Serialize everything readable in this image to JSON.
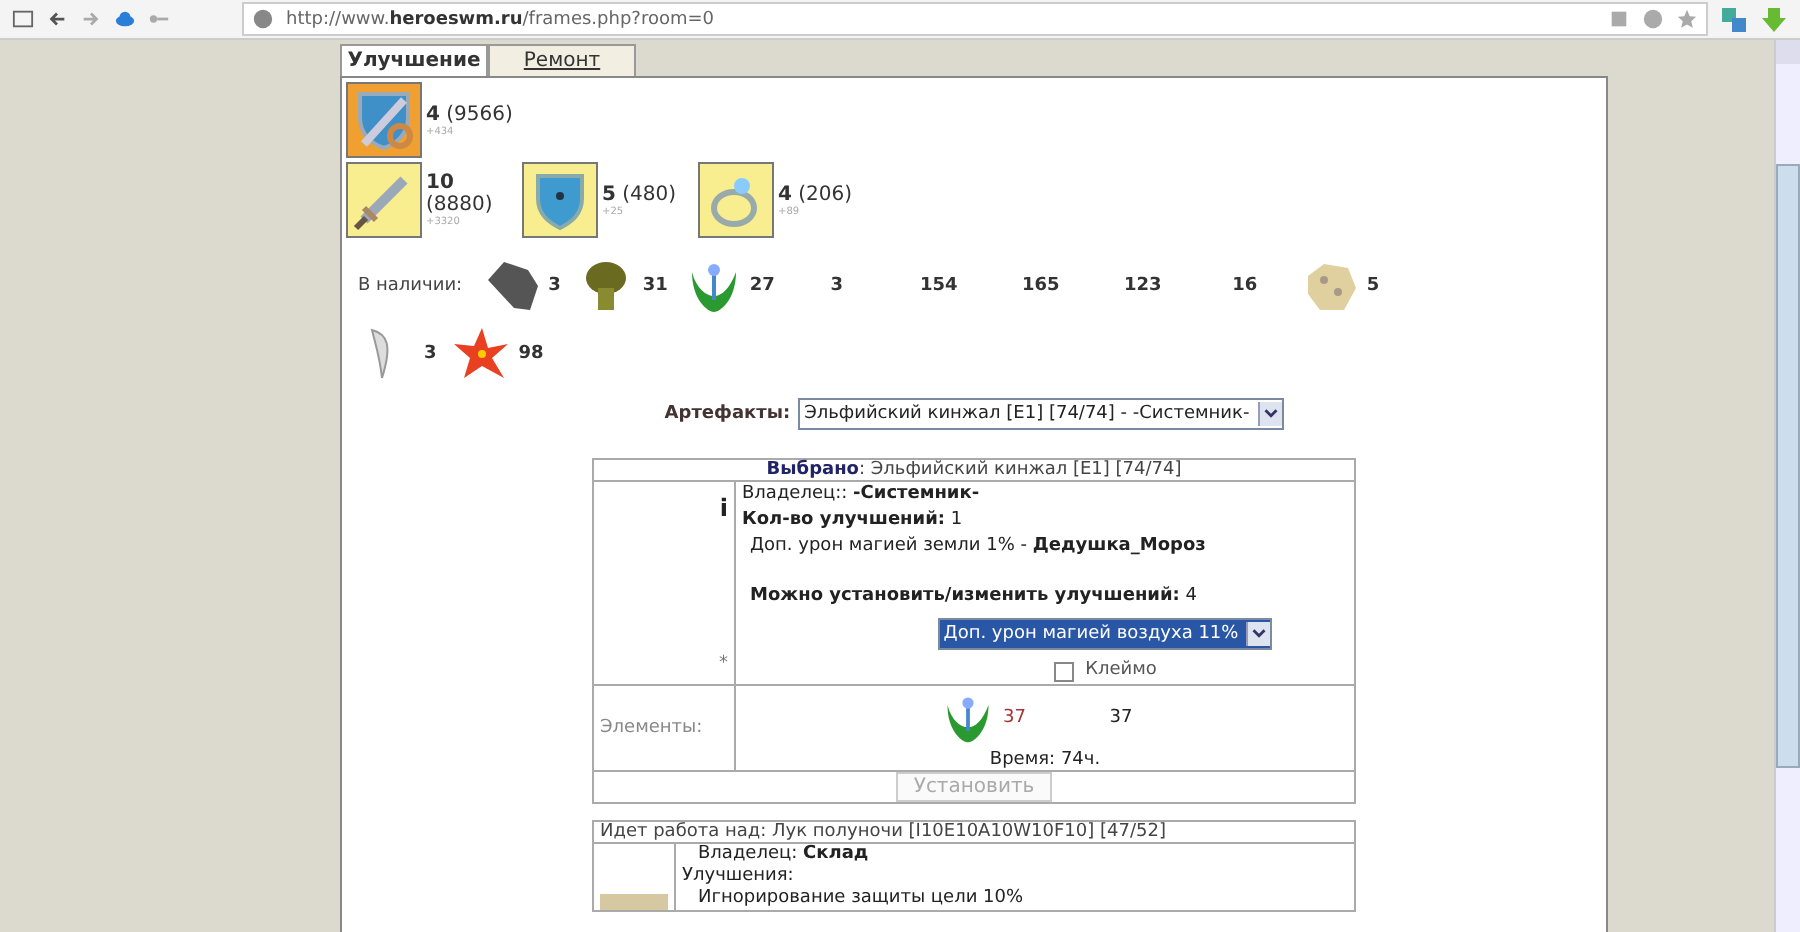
{
  "browser": {
    "url_prefix": "http://www.",
    "url_domain": "heroeswm.ru",
    "url_path": "/frames.php?room=0"
  },
  "tabs": [
    {
      "label": "Улучшение",
      "selected": true
    },
    {
      "label": "Ремонт",
      "selected": false
    }
  ],
  "equipment_rows": [
    [
      {
        "kind": "sword-shield",
        "level": "4",
        "points": "(9566)",
        "bonus": "+434"
      }
    ],
    [
      {
        "kind": "sword",
        "level": "10",
        "points": "(8880)",
        "bonus": "+3320",
        "wrap": true
      },
      {
        "kind": "shield",
        "level": "5",
        "points": "(480)",
        "bonus": "+25"
      },
      {
        "kind": "ring",
        "level": "4",
        "points": "(206)",
        "bonus": "+89"
      }
    ]
  ],
  "stock": {
    "label": "В наличии:",
    "items": [
      {
        "kind": "rock",
        "count": "3"
      },
      {
        "kind": "mushroom",
        "count": "31"
      },
      {
        "kind": "flower",
        "count": "27"
      },
      {
        "kind": "none",
        "count": "3"
      },
      {
        "kind": "none",
        "count": "154"
      },
      {
        "kind": "none",
        "count": "165"
      },
      {
        "kind": "none",
        "count": "123"
      },
      {
        "kind": "none",
        "count": "16"
      },
      {
        "kind": "stone",
        "count": "5"
      },
      {
        "kind": "fang",
        "count": "3"
      },
      {
        "kind": "lily",
        "count": "98"
      }
    ]
  },
  "artifacts": {
    "label": "Артефакты:",
    "value": "Эльфийский кинжал [E1] [74/74] - -Системник-"
  },
  "selected": {
    "info_mark": "i",
    "asterisk": "*",
    "label": "Выбрано",
    "value": ": Эльфийский кинжал [E1] [74/74]",
    "owner_label": "Владелец:: ",
    "owner": "-Системник-",
    "count_label": "Кол-во улучшений:",
    "count": "1",
    "upgrades": [
      {
        "name": "Доп. урон магией земли 1% - ",
        "author": "Дедушка_Мороз"
      }
    ],
    "can_label": "Можно установить/изменить улучшений:",
    "can": "4",
    "choice": "Доп. урон магией воздуха 11%",
    "stamp": {
      "label": "Клеймо",
      "checked": false
    },
    "elements_label": "Элементы:",
    "element": {
      "kind": "flower",
      "have": "37",
      "need": "37"
    },
    "time": "Время: 74ч.",
    "button": "Установить",
    "button_disabled": true
  },
  "work": {
    "title": "Идет работа над: Лук полуночи [I10E10A10W10F10] [47/52]",
    "owner_label": "Владелец: ",
    "owner": "Склад",
    "upgrades_label": "Улучшения:",
    "upgrades": [
      "Игнорирование защиты цели 10%"
    ]
  }
}
